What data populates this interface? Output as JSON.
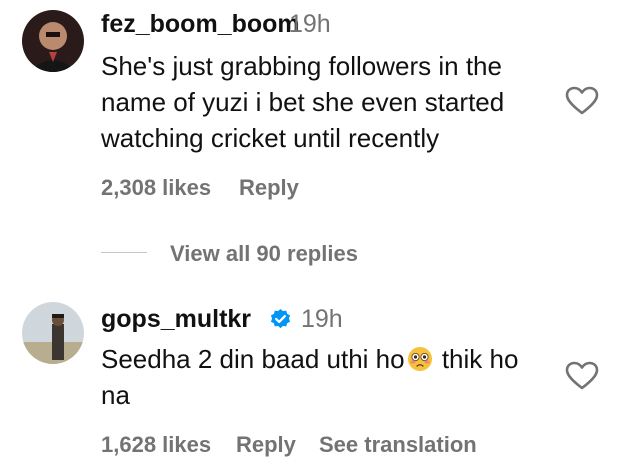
{
  "comments": [
    {
      "username": "fez_boom_boom",
      "time": "19h",
      "text": "She's just grabbing followers in the name of yuzi i bet she even started watching cricket until recently",
      "likes": "2,308 likes",
      "reply_label": "Reply",
      "view_replies": "View all 90 replies"
    },
    {
      "username": "gops_multkr",
      "time": "19h",
      "text_before": "Seedha 2 din baad uthi ho",
      "text_after": " thik ho na",
      "emoji": "flushed-face-emoji",
      "likes": "1,628 likes",
      "reply_label": "Reply",
      "translate_label": "See translation",
      "verified": true
    }
  ],
  "colors": {
    "text": "#111111",
    "muted": "#737373",
    "verified_blue": "#0095f6"
  }
}
